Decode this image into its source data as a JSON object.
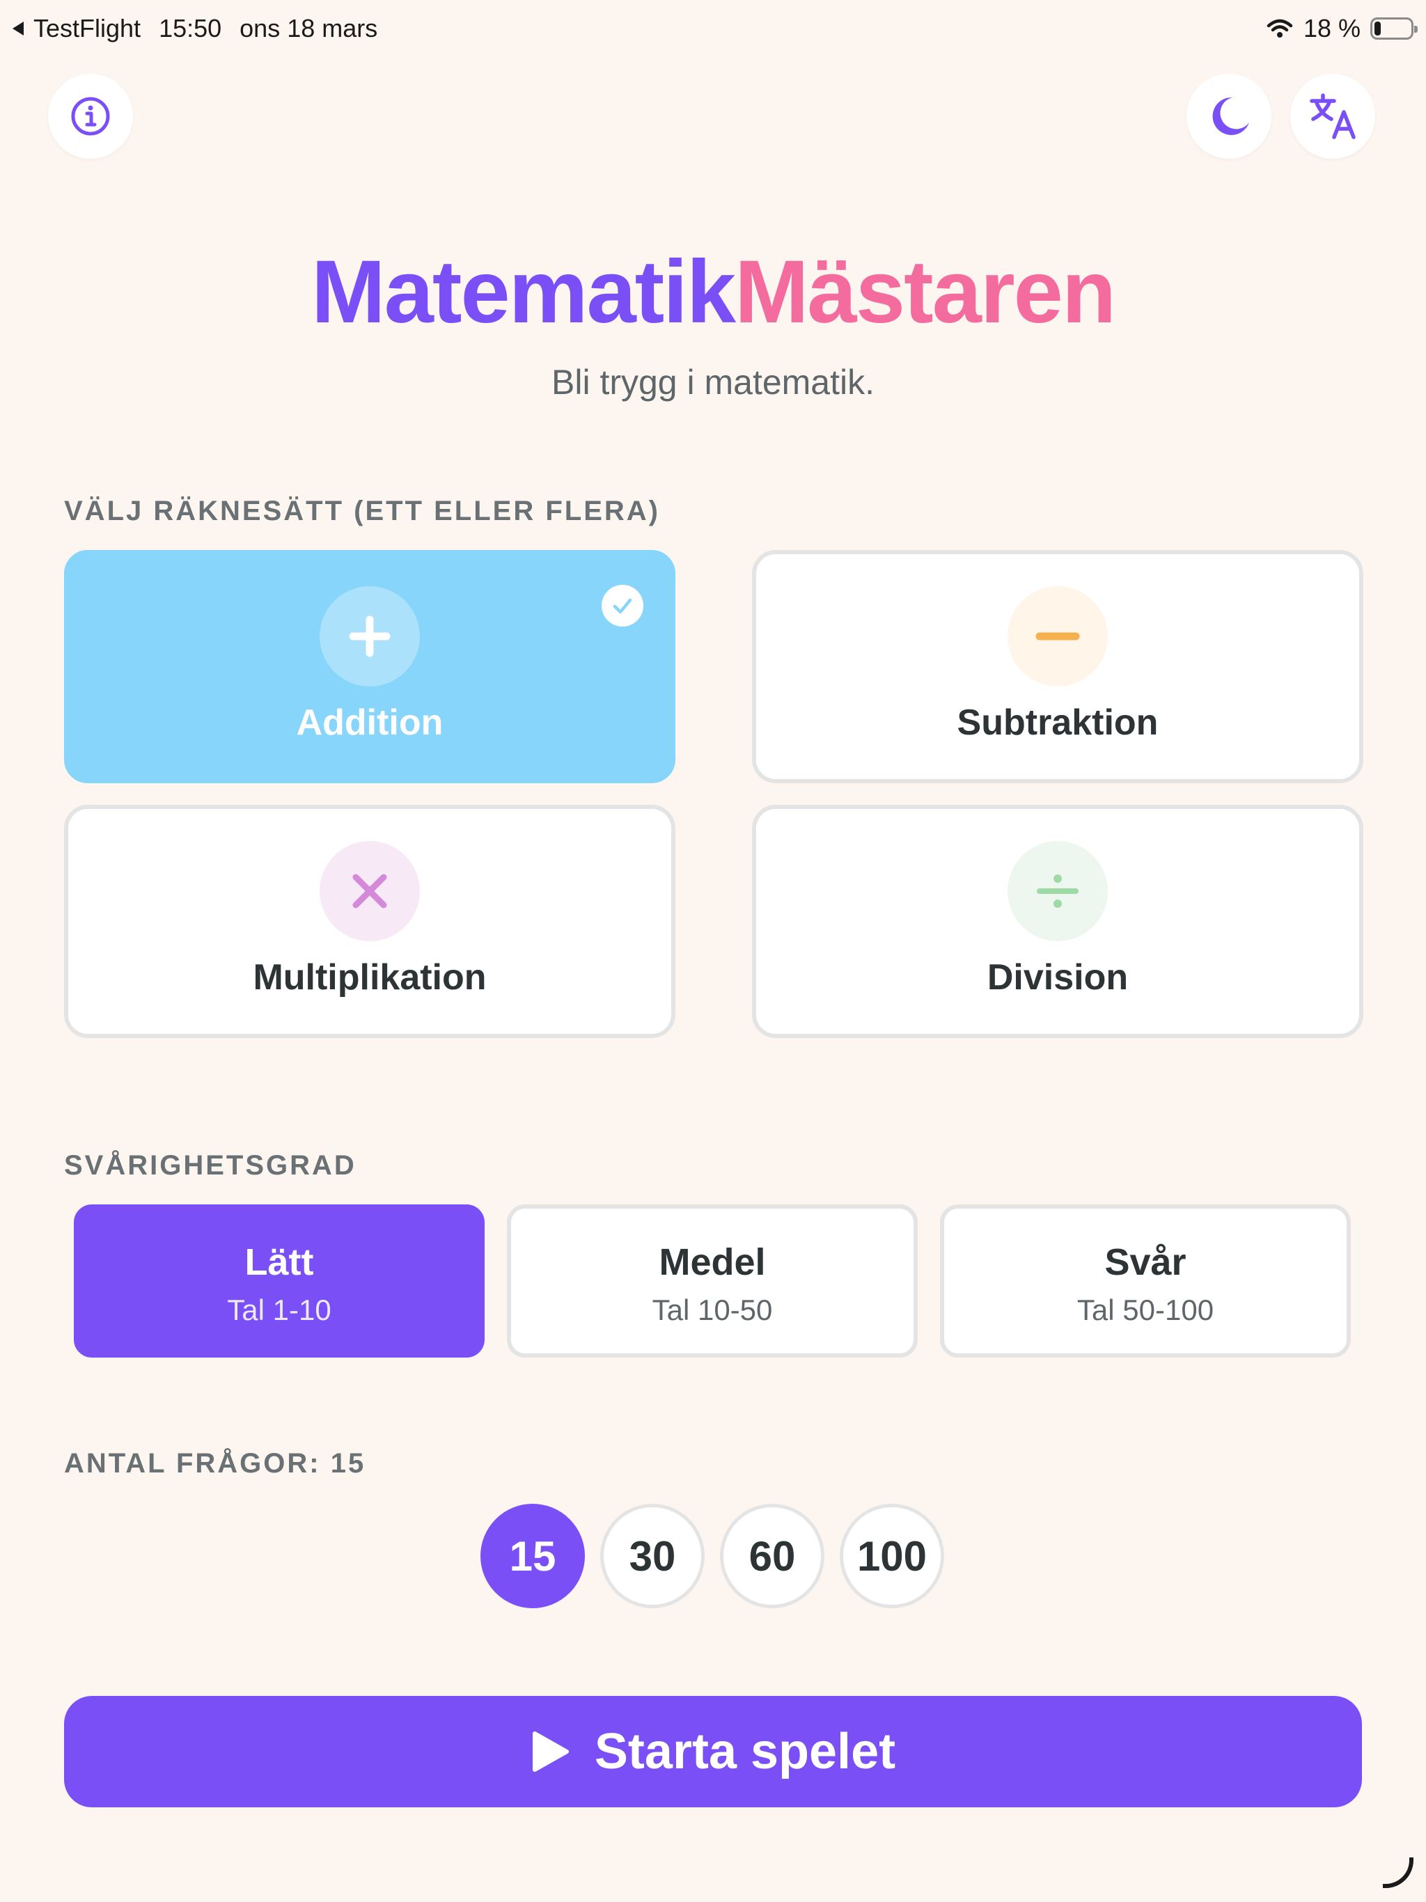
{
  "status_bar": {
    "back_app": "TestFlight",
    "time": "15:50",
    "date": "ons 18 mars",
    "battery_text": "18 %",
    "battery_level": 0.18
  },
  "header": {
    "info_icon": "info-icon",
    "dark_mode_icon": "moon-icon",
    "language_icon": "translate-icon"
  },
  "title": {
    "part1": "Matematik",
    "part2": "Mästaren",
    "subtitle": "Bli trygg i matematik."
  },
  "operations": {
    "label": "VÄLJ RÄKNESÄTT (ETT ELLER FLERA)",
    "items": [
      {
        "label": "Addition",
        "symbol": "+",
        "selected": true,
        "color": "#87d5fa"
      },
      {
        "label": "Subtraktion",
        "symbol": "−",
        "selected": false,
        "color": "#f6b04e"
      },
      {
        "label": "Multiplikation",
        "symbol": "×",
        "selected": false,
        "color": "#d48ad8"
      },
      {
        "label": "Division",
        "symbol": "÷",
        "selected": false,
        "color": "#9fd9a6"
      }
    ]
  },
  "difficulty": {
    "label": "SVÅRIGHETSGRAD",
    "items": [
      {
        "title": "Lätt",
        "sub": "Tal 1-10",
        "selected": true
      },
      {
        "title": "Medel",
        "sub": "Tal 10-50",
        "selected": false
      },
      {
        "title": "Svår",
        "sub": "Tal 50-100",
        "selected": false
      }
    ]
  },
  "questions": {
    "label": "ANTAL FRÅGOR: 15",
    "options": [
      "15",
      "30",
      "60",
      "100"
    ],
    "selected": "15"
  },
  "start_button": {
    "label": "Starta spelet",
    "icon": "play-icon"
  },
  "colors": {
    "accent": "#7b4ff6",
    "pink": "#f46c9d",
    "background": "#fdf6f0",
    "selected_op": "#87d5fa"
  }
}
